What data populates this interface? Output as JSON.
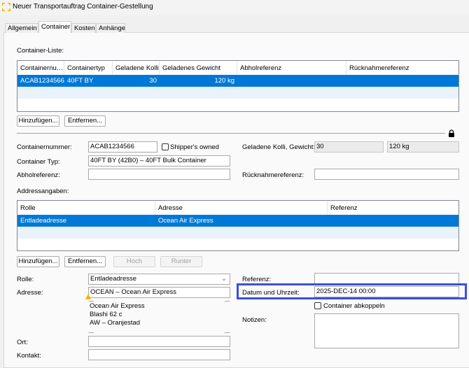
{
  "window": {
    "title": "Neuer Transportauftrag Container-Gestellung"
  },
  "tabs": [
    "Allgemein",
    "Container",
    "Kosten",
    "Anhänge"
  ],
  "container_list": {
    "label": "Container-Liste:",
    "columns": [
      "Containernu…",
      "Containertyp",
      "Geladene Kolli",
      "Geladenes Gewicht",
      "Abholreferenz",
      "Rücknahmereferenz"
    ],
    "rows": [
      {
        "number": "ACAB1234566",
        "type": "40FT BY",
        "kolli": "30",
        "gewicht": "120 kg",
        "abhol": "",
        "ruecknahme": ""
      }
    ],
    "add_label": "Hinzufügen...",
    "remove_label": "Entfernen..."
  },
  "details": {
    "containernummer_label": "Containernummer:",
    "containernummer": "ACAB1234566",
    "shippers_owned_label": "Shipper's owned",
    "shippers_owned": false,
    "kolli_gewicht_label": "Geladene Kolli, Gewicht:",
    "kolli": "30",
    "gewicht": "120 kg",
    "typ_label": "Container Typ:",
    "typ": "40FT BY (42B0) – 40FT Bulk Container",
    "abhol_label": "Abholreferenz:",
    "abhol": "",
    "ruecknahme_label": "Rücknahmereferenz:",
    "ruecknahme": ""
  },
  "addresses": {
    "label": "Addressangaben:",
    "columns": [
      "Rolle",
      "Adresse",
      "Referenz"
    ],
    "rows": [
      {
        "rolle": "Entladeadresse",
        "adresse": "Ocean Air Express",
        "referenz": ""
      }
    ],
    "add_label": "Hinzufügen...",
    "remove_label": "Entfernen...",
    "up_label": "Hoch",
    "down_label": "Runter"
  },
  "address_form": {
    "rolle_label": "Rolle:",
    "rolle": "Entladeadresse",
    "adresse_label": "Adresse:",
    "adresse": "OCEAN – Ocean Air Express",
    "address_lines": [
      "Ocean Air Express",
      "Blashi 62 c",
      "AW – Oranjestad"
    ],
    "ort_label": "Ort:",
    "ort": "",
    "kontakt_label": "Kontakt:",
    "kontakt": "",
    "referenz_label": "Referenz:",
    "referenz": "",
    "datum_label": "Datum und Uhrzeit:",
    "datum": "2025-DEC-14 00:00",
    "abkoppeln_label": "Container abkoppeln",
    "abkoppeln": false,
    "notizen_label": "Notizen:",
    "notizen": ""
  },
  "colors": {
    "selection": "#0078d7",
    "highlight": "#3a4fe0",
    "warning": "#f2b600"
  }
}
